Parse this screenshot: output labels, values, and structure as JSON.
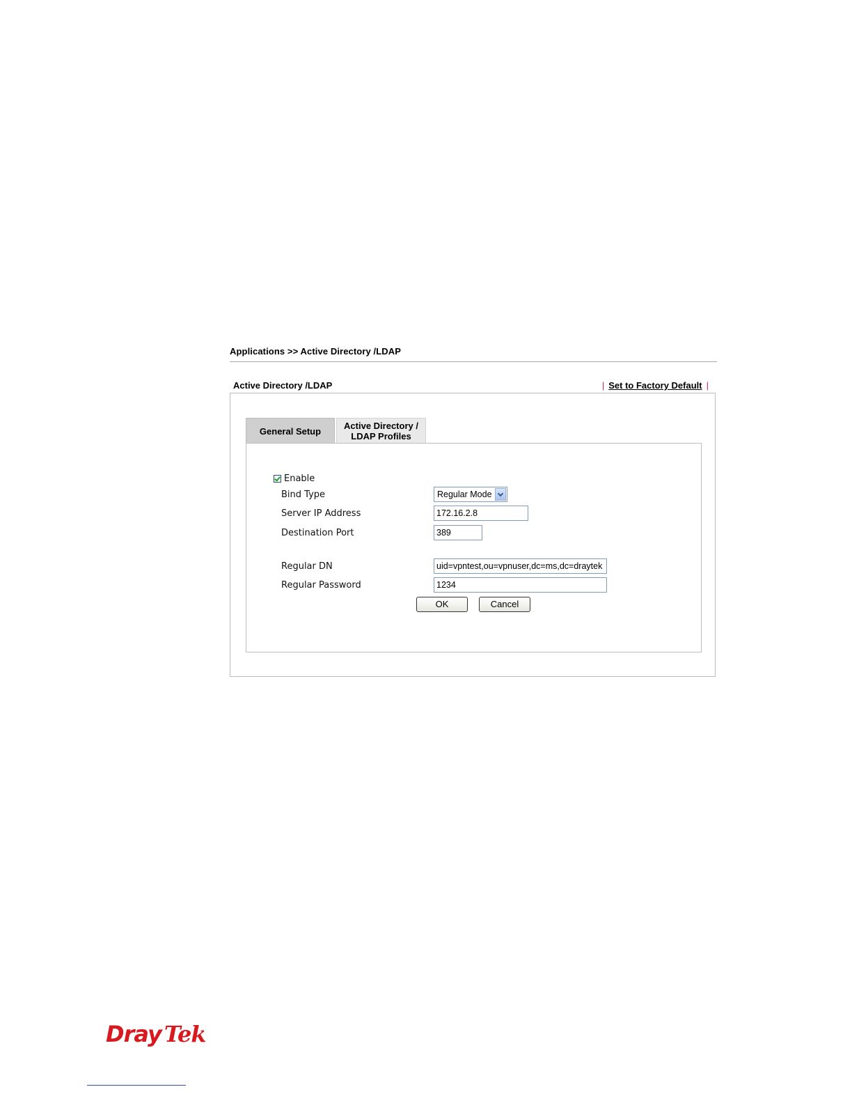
{
  "breadcrumb": "Applications >> Active Directory /LDAP",
  "section_title": "Active Directory /LDAP",
  "factory_default": {
    "separator": "|",
    "label": "Set to Factory Default"
  },
  "tabs": [
    {
      "label": "General Setup",
      "active": true
    },
    {
      "label_line1": "Active Directory /",
      "label_line2": "LDAP Profiles",
      "active": false
    }
  ],
  "form": {
    "enable": {
      "label": "Enable",
      "checked": true
    },
    "bind_type": {
      "label": "Bind Type",
      "value": "Regular Mode"
    },
    "server_ip": {
      "label": "Server IP Address",
      "value": "172.16.2.8"
    },
    "destination_port": {
      "label": "Destination Port",
      "value": "389"
    },
    "regular_dn": {
      "label": "Regular DN",
      "value": "uid=vpntest,ou=vpnuser,dc=ms,dc=draytek"
    },
    "regular_password": {
      "label": "Regular Password",
      "value": "1234"
    }
  },
  "buttons": {
    "ok": "OK",
    "cancel": "Cancel"
  },
  "logo": {
    "part1": "Dray",
    "part2": "Tek",
    "color": "#d71920"
  }
}
